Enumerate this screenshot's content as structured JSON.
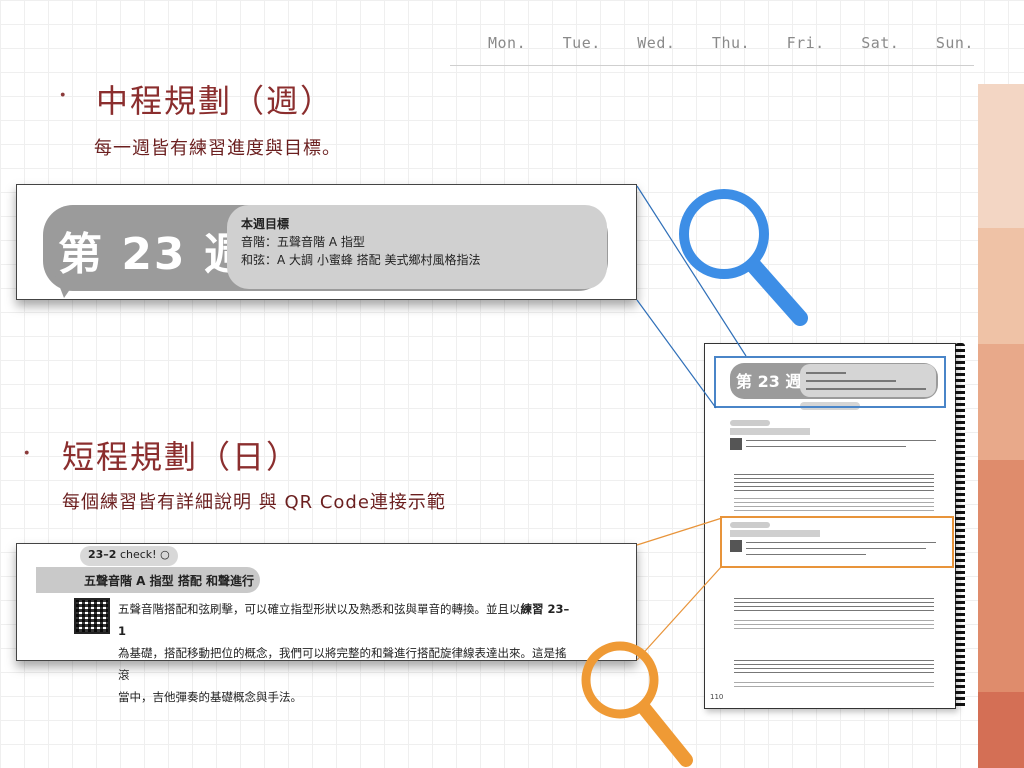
{
  "weekdays": [
    "Mon.",
    "Tue.",
    "Wed.",
    "Thu.",
    "Fri.",
    "Sat.",
    "Sun."
  ],
  "section_mid": {
    "bullet": "·",
    "title": "中程規劃（週）",
    "subtitle": "每一週皆有練習進度與目標。"
  },
  "week_card": {
    "label": "第 23 週",
    "goal_title": "本週目標",
    "goal_scale": "音階：五聲音階 A 指型",
    "goal_chord": "和弦：A 大調 小蜜蜂 搭配 美式鄉村風格指法"
  },
  "section_short": {
    "bullet": "·",
    "title": "短程規劃（日）",
    "subtitle": "每個練習皆有詳細說明 與 QR Code連接示範"
  },
  "exercise_card": {
    "number": "23–2",
    "check_label": "check! ○",
    "title": "五聲音階 A 指型 搭配 和聲進行",
    "line1_before": "五聲音階搭配和弦刷擊，可以確立指型形狀以及熟悉和弦與單音的轉換。並且以",
    "line1_bold": "練習 23–1",
    "line2": "為基礎，搭配移動把位的概念，我們可以將完整的和聲進行搭配旋律線表達出來。這是搖滾",
    "line3": "當中，吉他彈奏的基礎概念與手法。"
  },
  "book_page": {
    "week_label": "第 23 週",
    "page_number": "110"
  },
  "colors": {
    "heading": "#8b2e2e",
    "stripe_1": "#f3d6c4",
    "stripe_2": "#efc2a6",
    "stripe_3": "#e8a98a",
    "stripe_4": "#df8c6c",
    "stripe_5": "#d46f55",
    "magnifier_blue": "#3d8ee6",
    "magnifier_orange": "#ef9a35"
  },
  "icons": [
    "magnifier-icon",
    "magnifier-icon"
  ]
}
